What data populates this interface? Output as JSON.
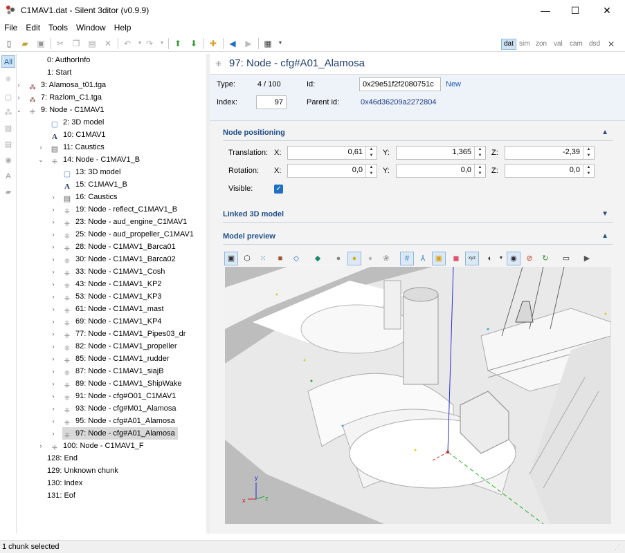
{
  "window": {
    "title": "C1MAV1.dat - Silent 3ditor (v0.9.9)",
    "minimize_glyph": "—",
    "maximize_glyph": "☐",
    "close_glyph": "✕"
  },
  "menu": [
    "File",
    "Edit",
    "Tools",
    "Window",
    "Help"
  ],
  "toolbar": {
    "icons": [
      "new-icon",
      "open-icon",
      "save-icon",
      "cut-icon",
      "copy-icon",
      "paste-icon",
      "delete-icon",
      "undo-icon",
      "redo-icon",
      "move-up-icon",
      "move-down-icon",
      "add-node-icon",
      "back-icon",
      "forward-icon",
      "view-list-icon"
    ],
    "views": [
      "dat",
      "sim",
      "zon",
      "val",
      "cam",
      "dsd"
    ],
    "active_view": "dat",
    "close_glyph": "✕"
  },
  "leftbar": {
    "filter_all": "All",
    "icons": [
      "node-filter-icon",
      "model-filter-icon",
      "material-filter-icon",
      "texture-filter-icon",
      "text-filter-icon",
      "sound-filter-icon",
      "font-filter-icon",
      "shape-filter-icon"
    ]
  },
  "tree": [
    {
      "label": "0: AuthorInfo",
      "icon": "",
      "expander": ""
    },
    {
      "label": "1: Start",
      "icon": "",
      "expander": ""
    },
    {
      "label": "3: Alamosa_t01.tga",
      "icon": "material-icon",
      "expander": "›"
    },
    {
      "label": "7: Razlom_C1.tga",
      "icon": "material-icon",
      "expander": "›"
    },
    {
      "label": "9: Node - C1MAV1",
      "icon": "node-icon",
      "expander": "⌄"
    },
    {
      "label": "2: 3D model",
      "icon": "model-icon",
      "expander": ""
    },
    {
      "label": "10: C1MAV1",
      "icon": "font-icon",
      "expander": ""
    },
    {
      "label": "11: Caustics",
      "icon": "text-icon",
      "expander": "›"
    },
    {
      "label": "14: Node - C1MAV1_B",
      "icon": "node-icon",
      "expander": "⌄"
    },
    {
      "label": "13: 3D model",
      "icon": "model-icon",
      "expander": ""
    },
    {
      "label": "15: C1MAV1_B",
      "icon": "font-icon",
      "expander": ""
    },
    {
      "label": "16: Caustics",
      "icon": "text-icon",
      "expander": "›"
    },
    {
      "label": "19: Node - reflect_C1MAV1_B",
      "icon": "node-icon",
      "expander": "›"
    },
    {
      "label": "23: Node - aud_engine_C1MAV1",
      "icon": "node-icon",
      "expander": "›"
    },
    {
      "label": "25: Node - aud_propeller_C1MAV1",
      "icon": "node-icon",
      "expander": "›"
    },
    {
      "label": "28: Node - C1MAV1_Barca01",
      "icon": "node-icon",
      "expander": "›"
    },
    {
      "label": "30: Node - C1MAV1_Barca02",
      "icon": "node-icon",
      "expander": "›"
    },
    {
      "label": "33: Node - C1MAV1_Cosh",
      "icon": "node-icon",
      "expander": "›"
    },
    {
      "label": "43: Node - C1MAV1_KP2",
      "icon": "node-icon",
      "expander": "›"
    },
    {
      "label": "53: Node - C1MAV1_KP3",
      "icon": "node-icon",
      "expander": "›"
    },
    {
      "label": "61: Node - C1MAV1_mast",
      "icon": "node-icon",
      "expander": "›"
    },
    {
      "label": "69: Node - C1MAV1_KP4",
      "icon": "node-icon",
      "expander": "›"
    },
    {
      "label": "77: Node - C1MAV1_Pipes03_dr",
      "icon": "node-icon",
      "expander": "›"
    },
    {
      "label": "82: Node - C1MAV1_propeller",
      "icon": "node-icon",
      "expander": "›"
    },
    {
      "label": "85: Node - C1MAV1_rudder",
      "icon": "node-icon",
      "expander": "›"
    },
    {
      "label": "87: Node - C1MAV1_siajB",
      "icon": "node-icon",
      "expander": "›"
    },
    {
      "label": "89: Node - C1MAV1_ShipWake",
      "icon": "node-icon",
      "expander": "›"
    },
    {
      "label": "91: Node - cfg#O01_C1MAV1",
      "icon": "node-icon",
      "expander": "›"
    },
    {
      "label": "93: Node - cfg#M01_Alamosa",
      "icon": "node-icon",
      "expander": "›"
    },
    {
      "label": "95: Node - cfg#A01_Alamosa",
      "icon": "node-icon",
      "expander": "›"
    },
    {
      "label": "97: Node - cfg#A01_Alamosa",
      "icon": "node-icon",
      "expander": "›",
      "selected": true
    },
    {
      "label": "100: Node - C1MAV1_F",
      "icon": "node-icon",
      "expander": "›"
    },
    {
      "label": "128: End",
      "icon": "",
      "expander": ""
    },
    {
      "label": "129: Unknown chunk",
      "icon": "",
      "expander": ""
    },
    {
      "label": "130: Index",
      "icon": "",
      "expander": ""
    },
    {
      "label": "131: Eof",
      "icon": "",
      "expander": ""
    }
  ],
  "details": {
    "title": "97: Node - cfg#A01_Alamosa",
    "type_label": "Type:",
    "type_value": "4 / 100",
    "id_label": "Id:",
    "id_value": "0x29e51f2f2080751c",
    "new_link": "New",
    "index_label": "Index:",
    "index_value": "97",
    "parent_label": "Parent id:",
    "parent_value": "0x46d36209a2272804"
  },
  "positioning": {
    "title": "Node positioning",
    "translation_label": "Translation:",
    "rotation_label": "Rotation:",
    "visible_label": "Visible:",
    "visible": true,
    "axes": [
      "X:",
      "Y:",
      "Z:"
    ],
    "translation": [
      "0,61",
      "1,365",
      "-2,39"
    ],
    "rotation": [
      "0,0",
      "0,0",
      "0,0"
    ]
  },
  "linked": {
    "title": "Linked 3D model"
  },
  "preview": {
    "title": "Model preview",
    "tools": [
      "box-view-icon",
      "wire-view-icon",
      "points-view-icon",
      "solid-view-icon",
      "bounds-view-icon",
      "texture-icon",
      "light-off-icon",
      "light-on-icon",
      "light-dim-icon",
      "light-multi-icon",
      "grid-icon",
      "axes-icon",
      "model-bounds-icon",
      "material-color-icon",
      "normals-icon",
      "shading-icon",
      "eye-icon",
      "hide-icon",
      "refresh-icon",
      "camera-icon",
      "play-icon"
    ],
    "axis_labels": {
      "x": "x",
      "y": "y",
      "z": "z"
    }
  },
  "status": {
    "text": "1 chunk selected"
  },
  "colors": {
    "accent": "#1f4e8a",
    "selection": "#d9d9d9",
    "link": "#1a56c4"
  }
}
